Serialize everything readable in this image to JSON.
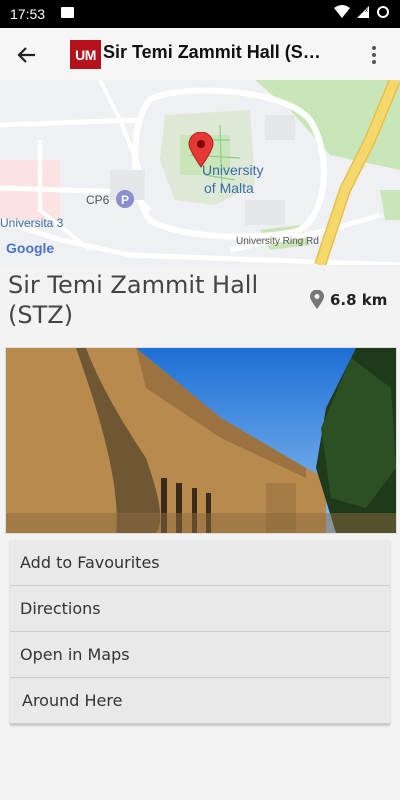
{
  "status_bar": {
    "time": "17:53"
  },
  "app_bar": {
    "logo_text": "UM",
    "title": "Sir Temi Zammit Hall (S…"
  },
  "map": {
    "labels": {
      "university": "University",
      "of_malta": "of Malta",
      "cp6": "CP6",
      "universita": "Universita 3",
      "ring_road": "University Ring Rd",
      "google": "Google"
    }
  },
  "place": {
    "name": "Sir Temi Zammit Hall (STZ)",
    "distance": "6.8 km"
  },
  "actions": [
    {
      "label": "Add to Favourites"
    },
    {
      "label": "Directions"
    },
    {
      "label": "Open in Maps"
    },
    {
      "label": "Around Here"
    }
  ],
  "colors": {
    "brand": "#b5121b",
    "map_park": "#c9e6b8",
    "map_road_major": "#f5d86b"
  }
}
